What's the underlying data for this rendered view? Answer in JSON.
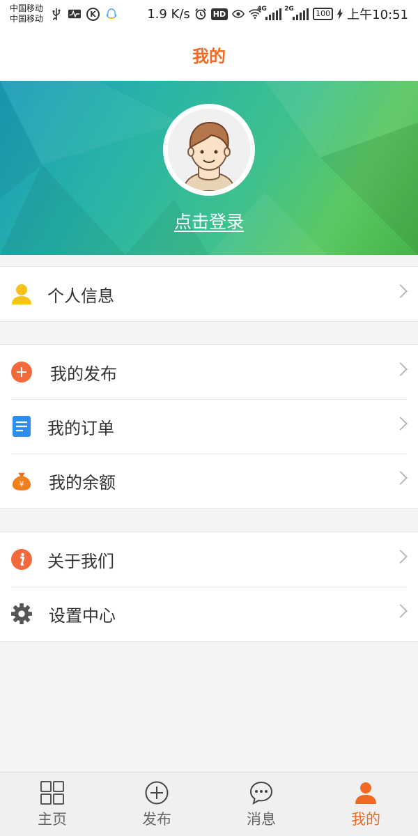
{
  "status_bar": {
    "carrier_1": "中国移动",
    "carrier_2": "中国移动",
    "speed": "1.9 K/s",
    "hd": "HD",
    "net_1": "4G",
    "net_2": "2G",
    "battery": "100",
    "time": "上午10:51"
  },
  "header": {
    "title": "我的"
  },
  "profile": {
    "login_text": "点击登录"
  },
  "menu": {
    "group1": [
      {
        "label": "个人信息",
        "icon": "person-icon"
      }
    ],
    "group2": [
      {
        "label": "我的发布",
        "icon": "plus-circle-icon"
      },
      {
        "label": "我的订单",
        "icon": "document-icon"
      },
      {
        "label": "我的余额",
        "icon": "money-bag-icon"
      }
    ],
    "group3": [
      {
        "label": "关于我们",
        "icon": "info-icon"
      },
      {
        "label": "设置中心",
        "icon": "gear-icon"
      }
    ]
  },
  "tabbar": {
    "tabs": [
      {
        "label": "主页",
        "icon": "grid-icon",
        "active": false
      },
      {
        "label": "发布",
        "icon": "plus-circle-icon",
        "active": false
      },
      {
        "label": "消息",
        "icon": "chat-bubble-icon",
        "active": false
      },
      {
        "label": "我的",
        "icon": "person-icon",
        "active": true
      }
    ]
  },
  "colors": {
    "accent": "#f06a24",
    "banner_start": "#1b9bb8",
    "banner_end": "#46b24a",
    "icon_yellow": "#f5c31c",
    "icon_orange": "#f26a3b",
    "icon_blue": "#2c8ef0"
  }
}
